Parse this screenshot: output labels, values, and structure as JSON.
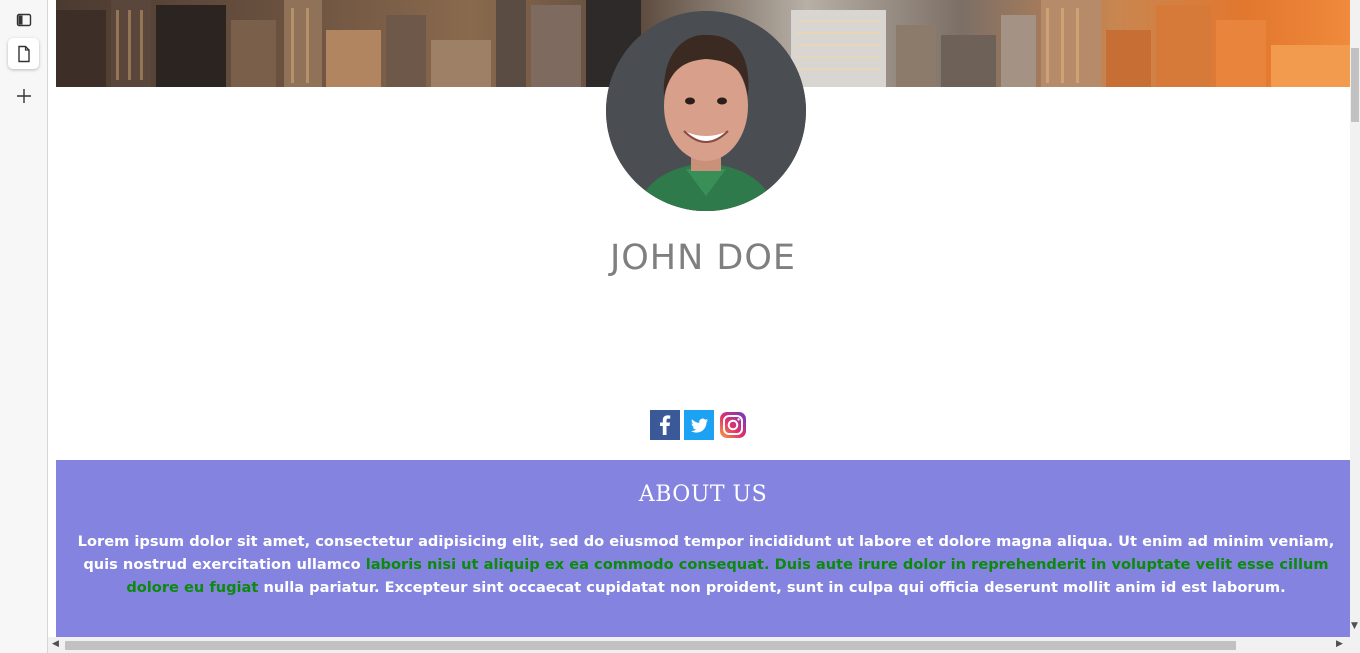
{
  "sidebar": {
    "icons": [
      "sidebar-panel-icon",
      "page-icon",
      "plus-icon"
    ]
  },
  "profile": {
    "name": "JOHN DOE"
  },
  "social": [
    "facebook-icon",
    "twitter-icon",
    "instagram-icon"
  ],
  "about": {
    "heading": "ABOUT US",
    "text_1": "Lorem ipsum dolor sit amet, consectetur adipisicing elit, sed do eiusmod tempor incididunt ut labore et dolore magna aliqua. Ut enim ad minim veniam, quis nostrud exercitation ullamco ",
    "text_green": "laboris nisi ut aliquip ex ea commodo consequat. Duis aute irure dolor in reprehenderit in voluptate velit esse cillum dolore eu fugiat",
    "text_2": " nulla pariatur. Excepteur sint occaecat cupidatat non proident, sunt in culpa qui officia deserunt mollit anim id est laborum."
  },
  "colors": {
    "about_bg": "#8484e0",
    "name": "#7f7f7f",
    "highlight": "#0b8a0b",
    "facebook": "#3b5998",
    "twitter": "#1da1f2"
  }
}
